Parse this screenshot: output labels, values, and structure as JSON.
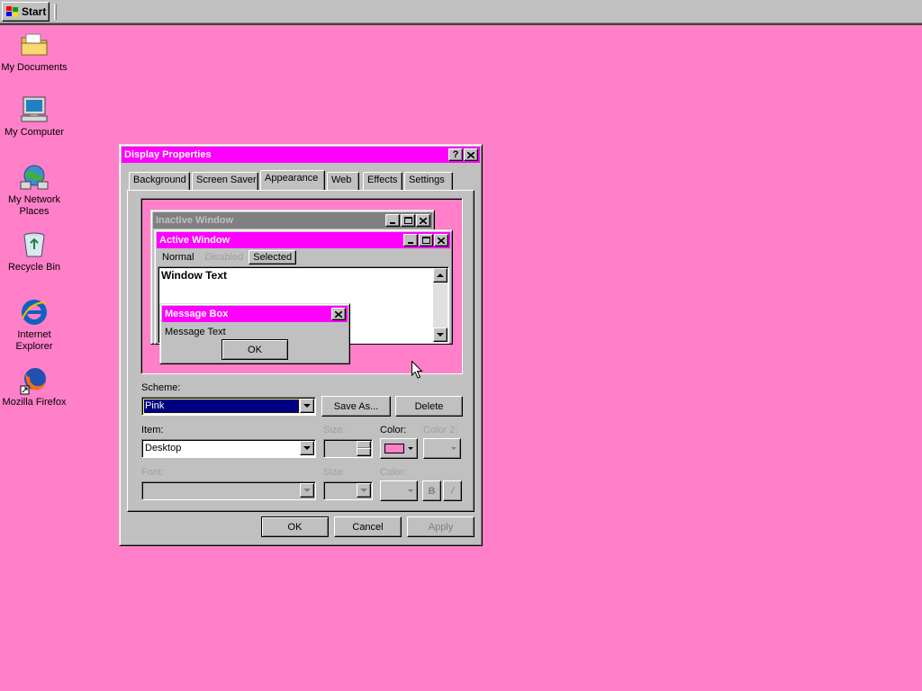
{
  "taskbar": {
    "start_label": "Start"
  },
  "desktop": {
    "icons": [
      {
        "label": "My Documents",
        "icon": "folder-documents-icon"
      },
      {
        "label": "My Computer",
        "icon": "computer-icon"
      },
      {
        "label": "My Network Places",
        "icon": "network-places-icon"
      },
      {
        "label": "Recycle Bin",
        "icon": "recycle-bin-icon"
      },
      {
        "label": "Internet Explorer",
        "icon": "internet-explorer-icon"
      },
      {
        "label": "Mozilla Firefox",
        "icon": "firefox-icon"
      }
    ]
  },
  "dialog": {
    "title": "Display Properties",
    "help_label": "?",
    "tabs": [
      "Background",
      "Screen Saver",
      "Appearance",
      "Web",
      "Effects",
      "Settings"
    ],
    "active_tab": "Appearance",
    "preview": {
      "inactive_title": "Inactive Window",
      "active_title": "Active Window",
      "menu": [
        "Normal",
        "Disabled",
        "Selected"
      ],
      "window_text": "Window Text",
      "msgbox_title": "Message Box",
      "msgbox_text": "Message Text",
      "msgbox_ok": "OK"
    },
    "scheme": {
      "label": "Scheme:",
      "value": "Pink",
      "save_as": "Save As...",
      "delete": "Delete"
    },
    "item": {
      "label": "Item:",
      "value": "Desktop",
      "size_label": "Size:",
      "color_label": "Color:",
      "color2_label": "Color 2:",
      "color_value": "#ff80c8"
    },
    "font": {
      "label": "Font:",
      "size_label": "Size:",
      "color_label": "Color:",
      "bold": "B",
      "italic": "/"
    },
    "buttons": {
      "ok": "OK",
      "cancel": "Cancel",
      "apply": "Apply"
    }
  },
  "colors": {
    "desktop": "#ff80c8",
    "title_active": "#ff00ff",
    "title_inactive": "#808080",
    "selection": "#000080"
  }
}
